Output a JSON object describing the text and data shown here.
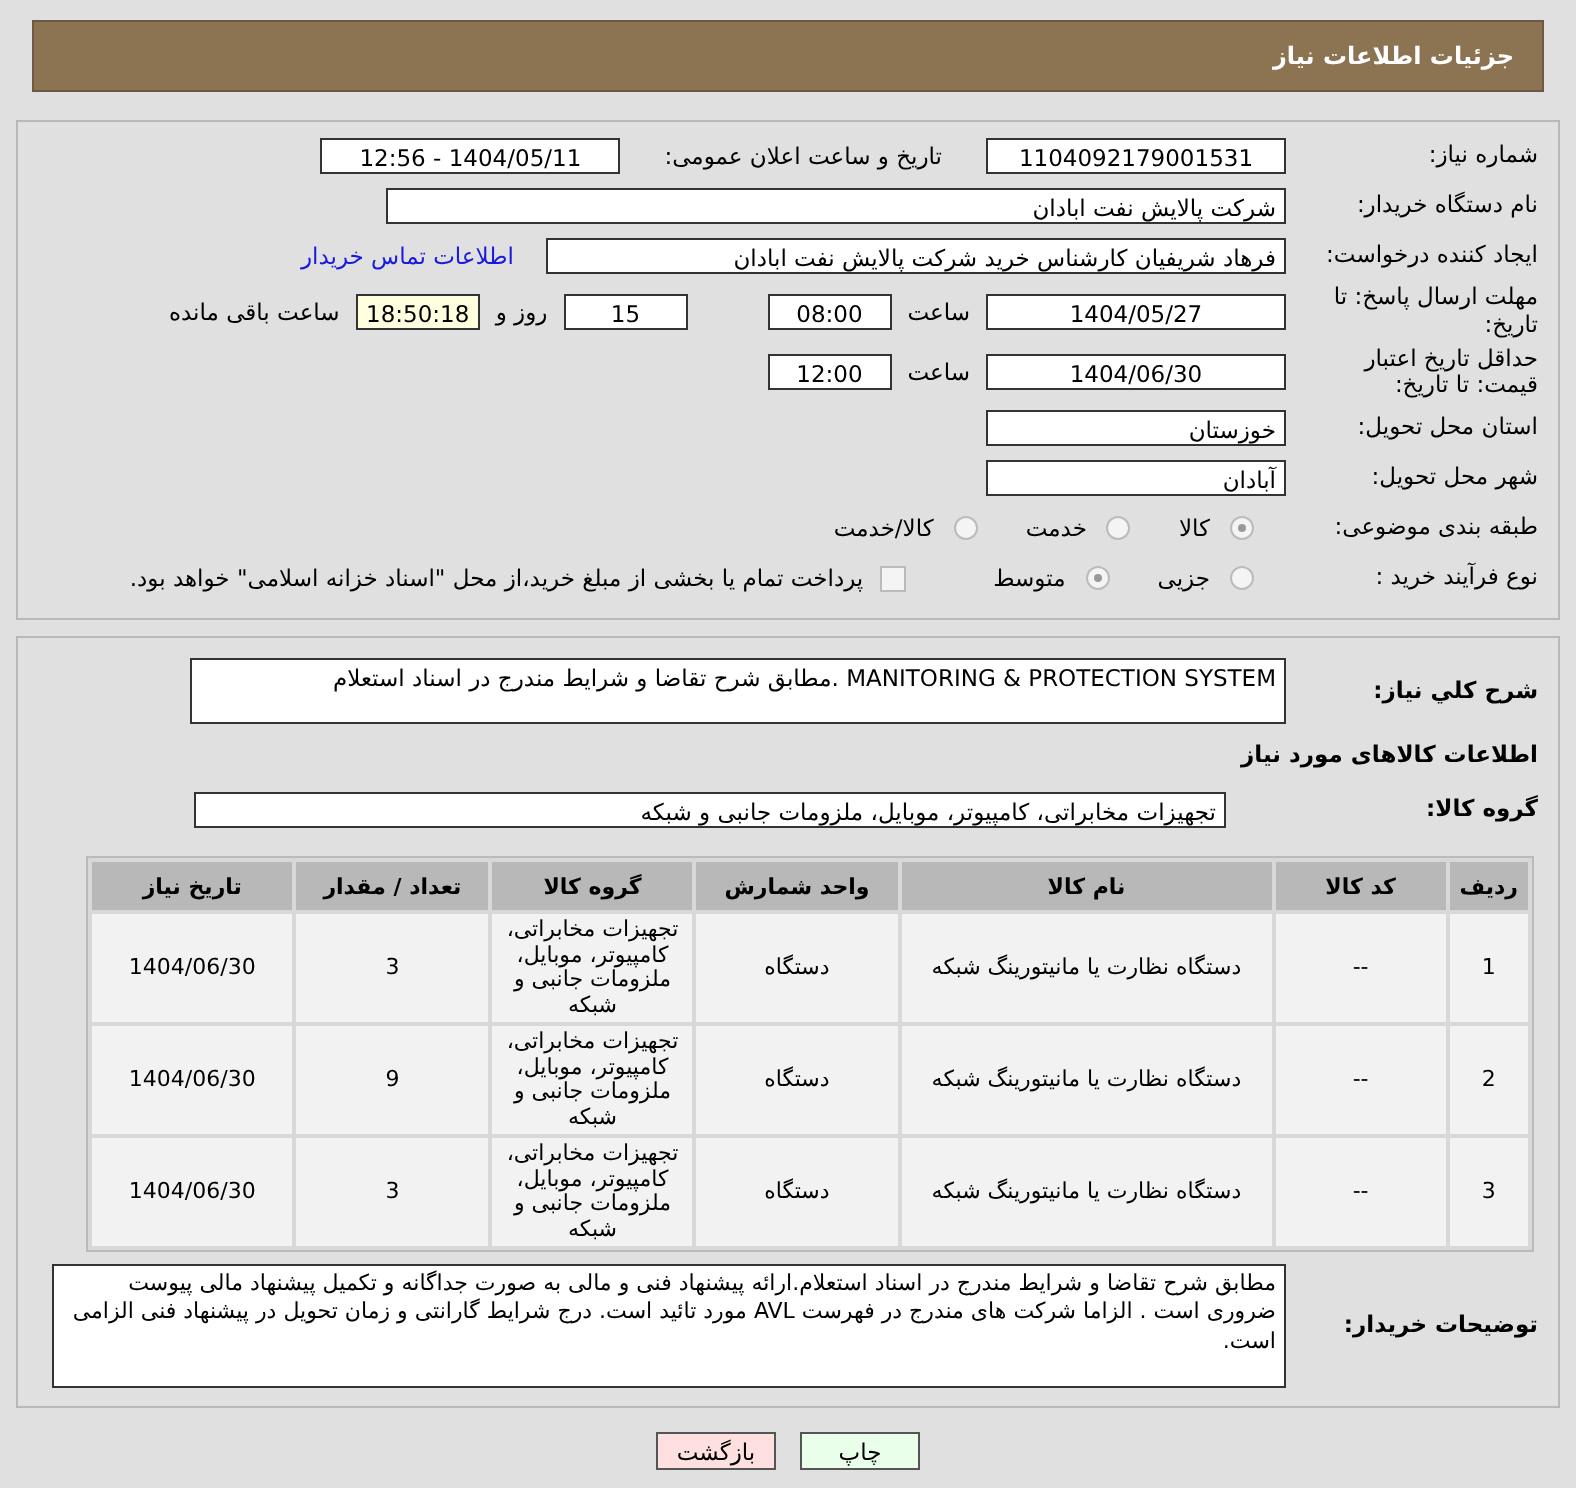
{
  "header": {
    "title": "جزئیات اطلاعات نیاز"
  },
  "need_number": {
    "label": "شماره نیاز:",
    "value": "1104092179001531"
  },
  "announce": {
    "label": "تاریخ و ساعت اعلان عمومی:",
    "value": "1404/05/11 - 12:56"
  },
  "buyer_org": {
    "label": "نام دستگاه خریدار:",
    "value": "شرکت پالایش نفت ابادان"
  },
  "requester": {
    "label": "ایجاد کننده درخواست:",
    "value": "فرهاد شریفیان کارشناس خرید شرکت پالایش نفت ابادان",
    "link": "اطلاعات تماس خریدار"
  },
  "deadline": {
    "label": "مهلت ارسال پاسخ: تا تاریخ:",
    "date": "1404/05/27",
    "time_label": "ساعت",
    "time": "08:00",
    "days": "15",
    "days_label": "روز و",
    "remaining": "18:50:18",
    "remaining_label": "ساعت باقی مانده"
  },
  "validity": {
    "label": "حداقل تاریخ اعتبار قیمت: تا تاریخ:",
    "date": "1404/06/30",
    "time_label": "ساعت",
    "time": "12:00"
  },
  "province": {
    "label": "استان محل تحویل:",
    "value": "خوزستان"
  },
  "city": {
    "label": "شهر محل تحویل:",
    "value": "آبادان"
  },
  "category": {
    "label": "طبقه بندی موضوعی:",
    "options": [
      {
        "label": "کالا",
        "selected": true
      },
      {
        "label": "خدمت",
        "selected": false
      },
      {
        "label": "کالا/خدمت",
        "selected": false
      }
    ]
  },
  "purchase_type": {
    "label": "نوع فرآیند خرید :",
    "options": [
      {
        "label": "جزیی",
        "selected": false
      },
      {
        "label": "متوسط",
        "selected": true
      }
    ],
    "payment_note": {
      "text": "پرداخت تمام یا بخشی از مبلغ خرید،از محل \"اسناد خزانه اسلامی\" خواهد بود.",
      "checked": false
    }
  },
  "description": {
    "label": "شرح کلي نياز:",
    "value": "MANITORING & PROTECTION SYSTEM .مطابق شرح تقاضا و شرایط مندرج در اسناد استعلام"
  },
  "goods_title": "اطلاعات کالاهای مورد نیاز",
  "goods_group": {
    "label": "گروه کالا:",
    "value": "تجهیزات مخابراتی، کامپیوتر، موبایل، ملزومات جانبی و شبکه"
  },
  "table": {
    "columns": [
      "ردیف",
      "کد کالا",
      "نام کالا",
      "واحد شمارش",
      "گروه کالا",
      "تعداد / مقدار",
      "تاریخ نیاز"
    ],
    "rows": [
      [
        "1",
        "--",
        "دستگاه نظارت یا مانیتورینگ شبکه",
        "دستگاه",
        "تجهیزات مخابراتی، کامپیوتر، موبایل، ملزومات جانبی و شبکه",
        "3",
        "1404/06/30"
      ],
      [
        "2",
        "--",
        "دستگاه نظارت یا مانیتورینگ شبکه",
        "دستگاه",
        "تجهیزات مخابراتی، کامپیوتر، موبایل، ملزومات جانبی و شبکه",
        "9",
        "1404/06/30"
      ],
      [
        "3",
        "--",
        "دستگاه نظارت یا مانیتورینگ شبکه",
        "دستگاه",
        "تجهیزات مخابراتی، کامپیوتر، موبایل، ملزومات جانبی و شبکه",
        "3",
        "1404/06/30"
      ]
    ]
  },
  "buyer_notes": {
    "label": "توضیحات خریدار:",
    "value": "مطابق شرح تقاضا و شرایط مندرج در اسناد استعلام.ارائه پیشنهاد فنی و مالی به صورت جداگانه و تکمیل پیشنهاد مالی پیوست ضروری است . الزاما شرکت های مندرج در فهرست AVL  مورد تائید است. درج شرایط گارانتی و زمان تحویل در پیشنهاد فنی الزامی است."
  },
  "buttons": [
    {
      "label": "چاپ",
      "kind": "print"
    },
    {
      "label": "بازگشت",
      "kind": "back"
    }
  ]
}
